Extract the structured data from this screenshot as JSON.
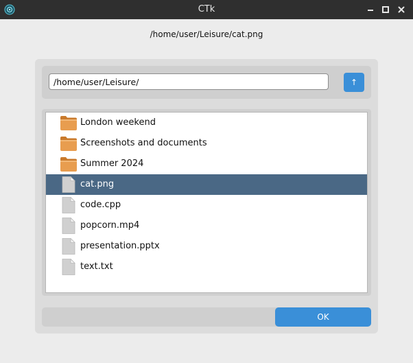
{
  "window": {
    "title": "CTk"
  },
  "header": {
    "selected_path": "/home/user/Leisure/cat.png"
  },
  "pathbar": {
    "value": "/home/user/Leisure/",
    "up_icon": "arrow-up-icon",
    "up_glyph": "↑"
  },
  "files": {
    "items": [
      {
        "label": "London weekend",
        "type": "folder"
      },
      {
        "label": "Screenshots and documents",
        "type": "folder"
      },
      {
        "label": "Summer 2024",
        "type": "folder"
      },
      {
        "label": "cat.png",
        "type": "file",
        "selected": true
      },
      {
        "label": "code.cpp",
        "type": "file"
      },
      {
        "label": "popcorn.mp4",
        "type": "file"
      },
      {
        "label": "presentation.pptx",
        "type": "file"
      },
      {
        "label": "text.txt",
        "type": "file"
      }
    ]
  },
  "footer": {
    "ok_label": "OK"
  },
  "colors": {
    "accent": "#3a8fd8",
    "selection": "#4a6885",
    "titlebar": "#2f2f2f",
    "folder": "#e39a4a"
  }
}
